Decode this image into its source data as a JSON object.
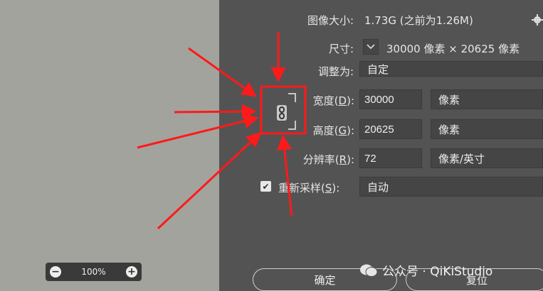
{
  "image_size": {
    "label": "图像大小:",
    "value": "1.73G (之前为1.26M)"
  },
  "dimensions": {
    "label": "尺寸:",
    "value": "30000 像素 × 20625 像素"
  },
  "fit_to": {
    "label": "调整为:",
    "value": "自定"
  },
  "width": {
    "label": "宽度(",
    "key": "D",
    "suffix": "):",
    "value": "30000",
    "unit": "像素"
  },
  "height": {
    "label": "高度(",
    "key": "G",
    "suffix": "):",
    "value": "20625",
    "unit": "像素"
  },
  "resolution": {
    "label": "分辨率(",
    "key": "R",
    "suffix": "):",
    "value": "72",
    "unit": "像素/英寸"
  },
  "resample": {
    "label": "重新采样(",
    "key": "S",
    "suffix": "):",
    "value": "自动",
    "checked": true
  },
  "preview": {
    "zoom": "100%",
    "zoom_out": "−",
    "zoom_in": "+"
  },
  "buttons": {
    "ok": "确定",
    "reset": "复位"
  },
  "watermark": "公众号 · QiKiStudio",
  "colors": {
    "annotation": "#ff1a1a",
    "preview_bg": "#a3a39d",
    "panel_bg": "#535353"
  }
}
